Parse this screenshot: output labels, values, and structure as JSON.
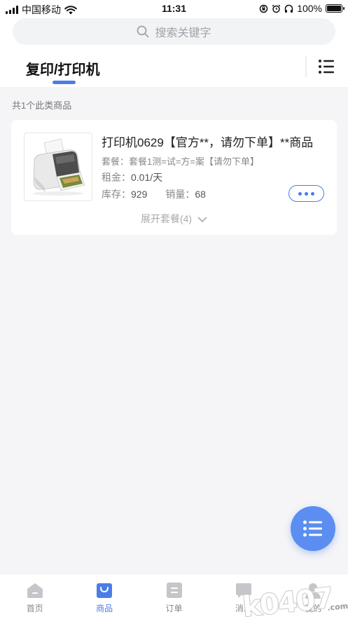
{
  "status_bar": {
    "carrier": "中国移动",
    "time": "11:31",
    "battery": "100%"
  },
  "search": {
    "placeholder": "搜索关键字"
  },
  "category": {
    "title": "复印/打印机"
  },
  "results": {
    "count_text": "共1个此类商品"
  },
  "product": {
    "title": "打印机0629【官方**，请勿下单】**商品",
    "package_label": "套餐：",
    "package_value": "套餐1测=试=方=案【请勿下单】",
    "rent_label": "租金：",
    "rent_value": "0.01/天",
    "stock_label": "库存：",
    "stock_value": "929",
    "sales_label": "销量：",
    "sales_value": "68",
    "expand_label": "展开套餐(4)"
  },
  "tabbar": {
    "items": [
      {
        "label": "首页",
        "icon": "home-icon"
      },
      {
        "label": "商品",
        "icon": "bag-icon"
      },
      {
        "label": "订单",
        "icon": "order-icon"
      },
      {
        "label": "消息",
        "icon": "message-icon"
      },
      {
        "label": "我的",
        "icon": "profile-icon"
      }
    ],
    "active_index": 1
  },
  "watermark": "k0407.com",
  "colors": {
    "accent": "#4a7de8",
    "fab": "#5b8ef0",
    "background": "#f5f5f7"
  }
}
